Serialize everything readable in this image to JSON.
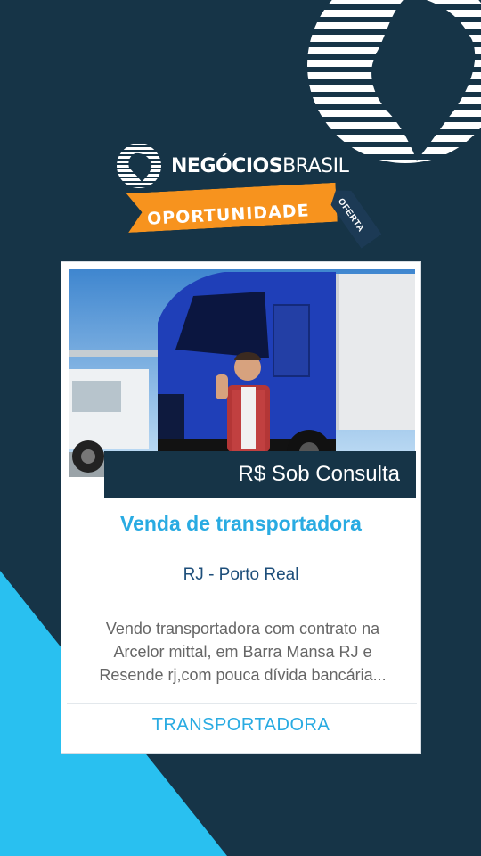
{
  "brand": {
    "name_bold": "NEGÓCIOS",
    "name_light": "BRASIL"
  },
  "ribbon": {
    "label": "OPORTUNIDADE",
    "tag": "OFERTA"
  },
  "listing": {
    "price": "R$ Sob Consulta",
    "title": "Venda de transportadora",
    "location": "RJ - Porto Real",
    "description": "Vendo transportadora com contrato na Arcelor mittal, em Barra Mansa RJ e Resende rj,com pouca dívida bancária...",
    "category": "TRANSPORTADORA"
  },
  "colors": {
    "background": "#163447",
    "accent_cyan": "#29abe2",
    "ribbon_orange": "#f7931e",
    "location_blue": "#1d4e7a"
  },
  "icons": {
    "globe": "globe-icon",
    "logo": "brazil-globe-logo-icon"
  }
}
